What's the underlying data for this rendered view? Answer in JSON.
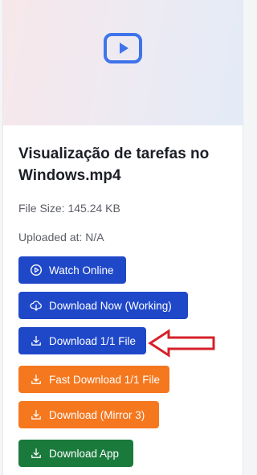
{
  "file": {
    "title": "Visualização de tarefas no Windows.mp4",
    "size": "File Size: 145.24 KB",
    "uploaded": "Uploaded at: N/A"
  },
  "buttons": {
    "watch_online": "Watch Online",
    "download_now": "Download Now (Working)",
    "download_file": "Download 1/1 File",
    "fast_download": "Fast Download 1/1 File",
    "download_mirror": "Download (Mirror 3)",
    "download_app": "Download App"
  },
  "colors": {
    "primary": "#1f48c9",
    "orange": "#f5771e",
    "green": "#1a7a3c",
    "annotation": "#d6202a",
    "play_icon": "#3f73ea"
  },
  "icons": {
    "hero": "video-play-icon",
    "watch": "play-circle-icon",
    "download_now": "cloud-download-icon",
    "download": "download-tray-icon",
    "annotation": "left-arrow-annotation"
  }
}
